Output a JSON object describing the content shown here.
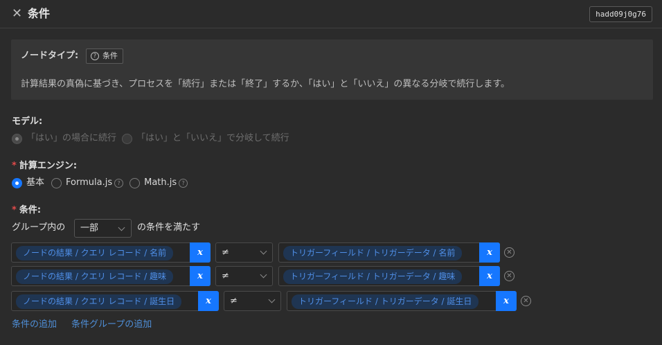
{
  "header": {
    "title": "条件",
    "node_id": "hadd09j0g76"
  },
  "node_type": {
    "label": "ノードタイプ:",
    "tag": "条件",
    "description": "計算結果の真偽に基づき、プロセスを「続行」または「終了」するか、「はい」と「いいえ」の異なる分岐で続行します。"
  },
  "mode": {
    "label": "モデル:",
    "options": [
      "「はい」の場合に続行",
      "「はい」と「いいえ」で分岐して続行"
    ],
    "selected": 0,
    "disabled": true
  },
  "engine": {
    "label": "計算エンジン:",
    "options": [
      "基本",
      "Formula.js",
      "Math.js"
    ],
    "selected": 0
  },
  "conditions": {
    "label": "条件:",
    "prefix": "グループ内の",
    "group_mode": "一部",
    "suffix": "の条件を満たす",
    "rows": [
      {
        "left": "ノードの結果 / クエリ レコード / 名前",
        "operator": "≠",
        "right": "トリガーフィールド / トリガーデータ / 名前"
      },
      {
        "left": "ノードの結果 / クエリ レコード / 趣味",
        "operator": "≠",
        "right": "トリガーフィールド / トリガーデータ / 趣味"
      },
      {
        "left": "ノードの結果 / クエリ レコード / 誕生日",
        "operator": "≠",
        "right": "トリガーフィールド / トリガーデータ / 誕生日"
      }
    ],
    "variable_button": "x",
    "add_condition": "条件の追加",
    "add_group": "条件グループの追加"
  },
  "colors": {
    "accent": "#1677ff",
    "required": "#e04a4a",
    "link": "#4f8fd8"
  }
}
